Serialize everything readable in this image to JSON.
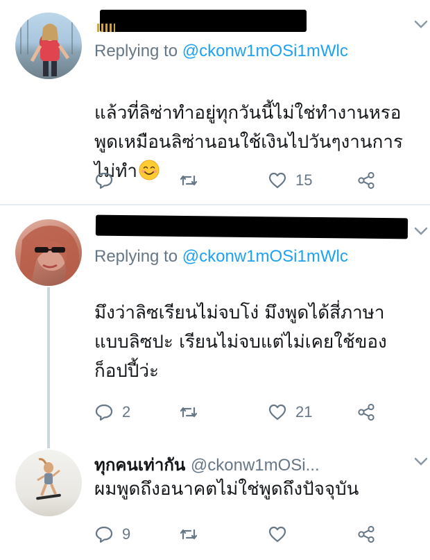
{
  "tweets": [
    {
      "replying_prefix": "Replying to ",
      "replying_handle": "@ckonw1mOSi1mWlc",
      "text": "แล้วที่ลิซ่าทำอยู่ทุกวันนี้ไม่ใช่ทำงานหรอ\nพูดเหมือนลิซ่านอนใช้เงินไปวันๆงานการ\nไม่ทำ",
      "emoji": "smiling-face-emoji",
      "reply_count": "",
      "retweet_count": "",
      "like_count": "15"
    },
    {
      "replying_prefix": "Replying to ",
      "replying_handle": "@ckonw1mOSi1mWlc",
      "text": "มึงว่าลิซเรียนไม่จบโง่ มึงพูดได้สี่ภาษา\nแบบลิซปะ เรียนไม่จบแต่ไม่เคยใช้ของ\nก็อปปี้ว่ะ",
      "reply_count": "2",
      "retweet_count": "",
      "like_count": "21"
    },
    {
      "display_name": "ทุกคนเท่ากัน",
      "handle": "@ckonw1mOSi...",
      "text": "ผมพูดถึงอนาคตไม่ใช่พูดถึงปัจจุบัน",
      "reply_count": "9",
      "retweet_count": "",
      "like_count": ""
    }
  ],
  "colors": {
    "accent": "#1da1f2",
    "secondary_text": "#657786",
    "divider": "#e6ecf0",
    "thread_line": "#ccd6dd"
  }
}
